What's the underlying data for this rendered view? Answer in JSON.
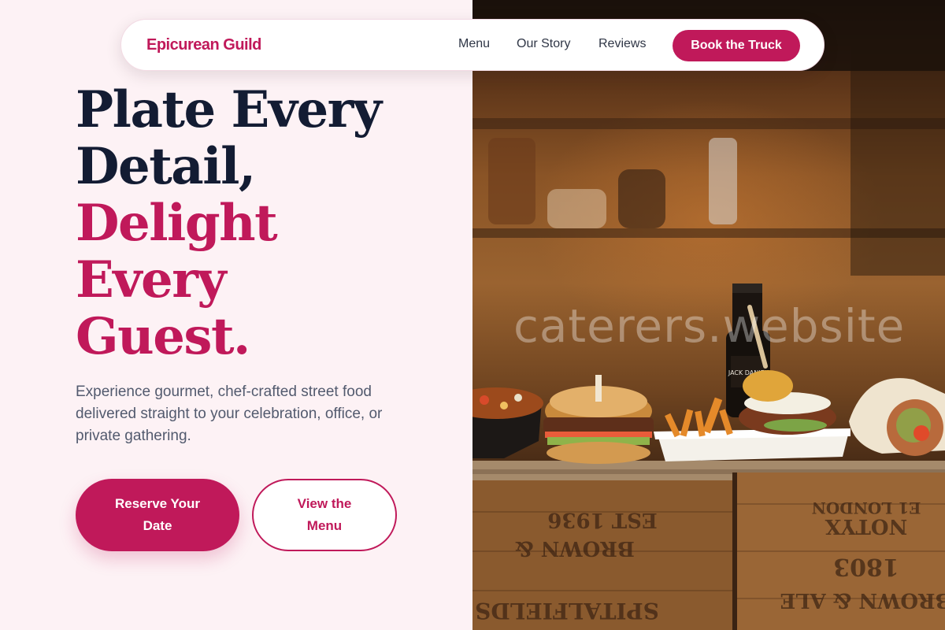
{
  "nav": {
    "brand": "Epicurean Guild",
    "links": [
      "Menu",
      "Our Story",
      "Reviews"
    ],
    "cta": "Book the Truck"
  },
  "hero": {
    "title_lines": [
      {
        "text": "Plate Every",
        "style": "dark"
      },
      {
        "text": "Detail,",
        "style": "dark"
      },
      {
        "text": "Delight",
        "style": "accent"
      },
      {
        "text": "Every",
        "style": "accent"
      },
      {
        "text": "Guest.",
        "style": "accent"
      }
    ],
    "subtitle": "Experience gourmet, chef-crafted street food delivered straight to your celebration, office, or private gathering.",
    "primary_button": "Reserve Your Date",
    "secondary_button": "View the Menu"
  },
  "photo": {
    "watermark": "caterers.website",
    "crate_text_left": [
      "EST 1936",
      "BROWN &",
      "SPITALFIELDS"
    ],
    "crate_text_right": [
      "E1 LONDON",
      "NOTYX",
      "1803",
      "BROWN & ALE"
    ],
    "bottle_label": "JACK DANIEL"
  },
  "colors": {
    "accent": "#c0195a",
    "heading_dark": "#131c33",
    "body_text": "#525a6e",
    "page_bg": "#fdf2f5"
  }
}
